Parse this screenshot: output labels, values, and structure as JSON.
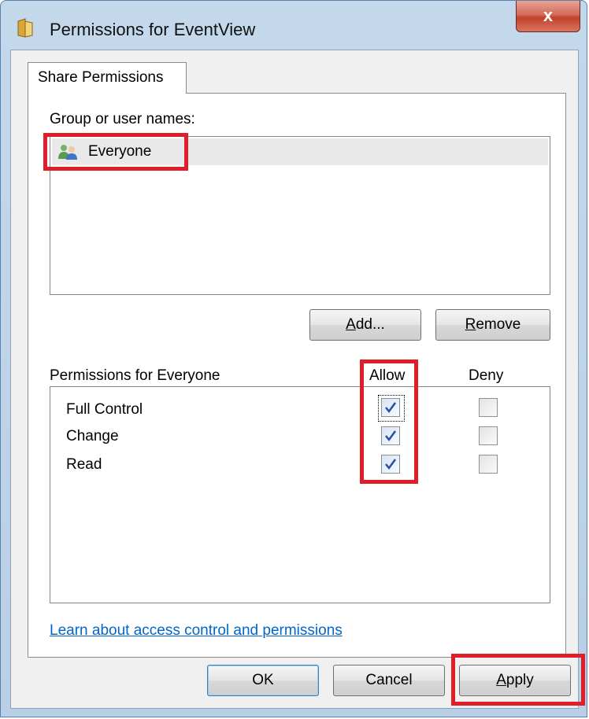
{
  "window": {
    "title": "Permissions for EventView",
    "close_label": "x"
  },
  "tabs": [
    {
      "label": "Share Permissions"
    }
  ],
  "groups": {
    "label": "Group or user names:",
    "items": [
      {
        "name": "Everyone",
        "icon": "users-icon"
      }
    ]
  },
  "buttons": {
    "add": "Add...",
    "remove": "Remove",
    "ok": "OK",
    "cancel": "Cancel",
    "apply": "Apply"
  },
  "permissions": {
    "title": "Permissions for Everyone",
    "col_allow": "Allow",
    "col_deny": "Deny",
    "rows": [
      {
        "name": "Full Control",
        "allow": true,
        "deny": false
      },
      {
        "name": "Change",
        "allow": true,
        "deny": false
      },
      {
        "name": "Read",
        "allow": true,
        "deny": false
      }
    ]
  },
  "help_link": "Learn about access control and permissions",
  "colors": {
    "highlight": "#e01e2a",
    "link": "#0066cc",
    "close_button": "#c2412b"
  }
}
